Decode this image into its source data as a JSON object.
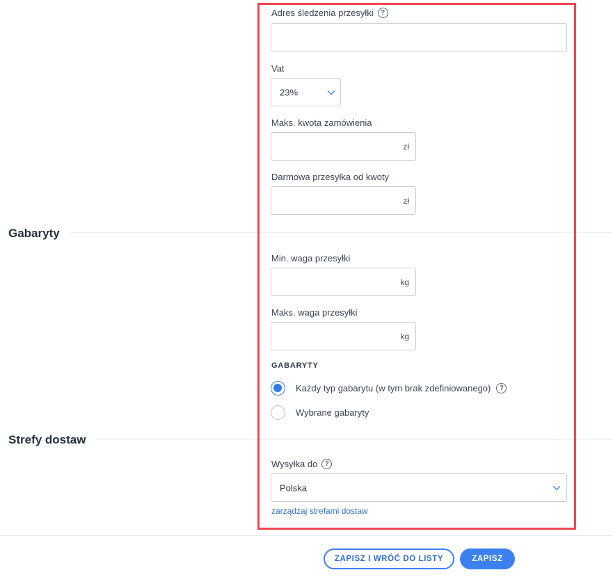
{
  "sections": {
    "dimensions_title": "Gabaryty",
    "zones_title": "Strefy dostaw"
  },
  "tracking": {
    "label": "Adres śledzenia przesyłki",
    "value": "",
    "help_icon": "question-circle-icon"
  },
  "vat": {
    "label": "Vat",
    "selected": "23%"
  },
  "max_order": {
    "label": "Maks. kwota zamówienia",
    "value": "",
    "suffix": "zł"
  },
  "free_shipping": {
    "label": "Darmowa przesyłka od kwoty",
    "value": "",
    "suffix": "zł"
  },
  "min_weight": {
    "label": "Min. waga przesyłki",
    "value": "",
    "suffix": "kg"
  },
  "max_weight": {
    "label": "Maks. waga przesyłki",
    "value": "",
    "suffix": "kg"
  },
  "dimensions": {
    "heading": "GABARYTY",
    "options": [
      {
        "label": "Każdy typ gabarytu (w tym brak zdefiniowanego)",
        "checked": true
      },
      {
        "label": "Wybrane gabaryty",
        "checked": false
      }
    ]
  },
  "shipping_to": {
    "label": "Wysyłka do",
    "selected": "Polska",
    "manage_link": "zarządzaj strefami dostaw"
  },
  "footer": {
    "save_return_label": "ZAPISZ I WRÓĆ DO LISTY",
    "save_label": "ZAPISZ"
  },
  "colors": {
    "accent": "#3b82f0",
    "highlight_border": "#f04550",
    "link": "#2f6fd1"
  }
}
